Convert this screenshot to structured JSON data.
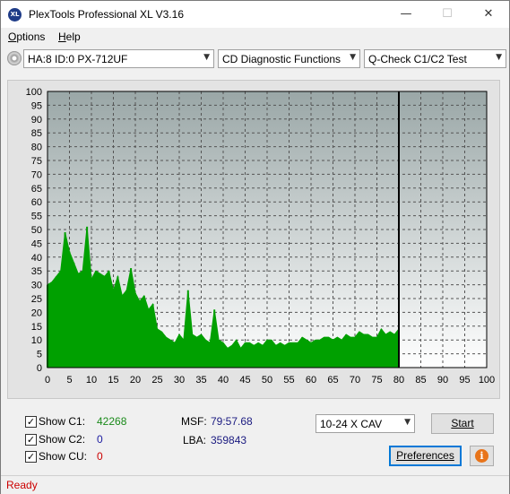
{
  "window": {
    "title": "PlexTools Professional XL V3.16",
    "app_icon_text": "XL",
    "minimize_glyph": "—",
    "maximize_glyph": "☐",
    "close_glyph": "✕"
  },
  "menu": {
    "options": {
      "underline": "O",
      "rest": "ptions"
    },
    "help": {
      "underline": "H",
      "rest": "elp"
    }
  },
  "toolbar": {
    "drive_select": "HA:8 ID:0  PX-712UF",
    "function_select": "CD Diagnostic Functions",
    "test_select": "Q-Check C1/C2 Test",
    "arrow_glyph": "▼"
  },
  "chart_data": {
    "type": "area",
    "title": "",
    "xlabel": "",
    "ylabel": "",
    "xlim": [
      0,
      100
    ],
    "ylim": [
      0,
      100
    ],
    "x_ticks": [
      0,
      5,
      10,
      15,
      20,
      25,
      30,
      35,
      40,
      45,
      50,
      55,
      60,
      65,
      70,
      75,
      80,
      85,
      90,
      95,
      100
    ],
    "y_ticks": [
      0,
      5,
      10,
      15,
      20,
      25,
      30,
      35,
      40,
      45,
      50,
      55,
      60,
      65,
      70,
      75,
      80,
      85,
      90,
      95,
      100
    ],
    "grid": true,
    "end_marker_x": 80,
    "series": [
      {
        "color": "#00a000",
        "x": [
          0,
          1,
          2,
          3,
          4,
          5,
          6,
          7,
          8,
          9,
          10,
          11,
          12,
          13,
          14,
          15,
          16,
          17,
          18,
          19,
          20,
          21,
          22,
          23,
          24,
          25,
          26,
          27,
          28,
          29,
          30,
          31,
          32,
          33,
          34,
          35,
          36,
          37,
          38,
          39,
          40,
          41,
          42,
          43,
          44,
          45,
          46,
          47,
          48,
          49,
          50,
          51,
          52,
          53,
          54,
          55,
          56,
          57,
          58,
          59,
          60,
          61,
          62,
          63,
          64,
          65,
          66,
          67,
          68,
          69,
          70,
          71,
          72,
          73,
          74,
          75,
          76,
          77,
          78,
          79,
          80
        ],
        "y": [
          30,
          31,
          33,
          35,
          49,
          42,
          38,
          34,
          35,
          51,
          32,
          35,
          34,
          33,
          35,
          28,
          33,
          26,
          28,
          36,
          27,
          24,
          26,
          21,
          23,
          14,
          13,
          11,
          10,
          9,
          12,
          10,
          28,
          12,
          11,
          12,
          10,
          9,
          21,
          10,
          9,
          7,
          8,
          10,
          7,
          9,
          9,
          8,
          9,
          8,
          10,
          10,
          8,
          9,
          8,
          9,
          9,
          9,
          11,
          10,
          9,
          10,
          10,
          11,
          11,
          10,
          11,
          10,
          12,
          11,
          11,
          13,
          12,
          12,
          11,
          11,
          14,
          12,
          13,
          12,
          14
        ]
      }
    ]
  },
  "options": {
    "show_c1_label": "Show C1:",
    "show_c1_value": "42268",
    "show_c2_label": "Show C2:",
    "show_c2_value": "0",
    "show_cu_label": "Show CU:",
    "show_cu_value": "0",
    "check_glyph": "✓",
    "c1_color": "#1a8a1a",
    "c2_color": "#1a1aa0",
    "cu_color": "#cc0000"
  },
  "info": {
    "msf_label": "MSF:",
    "msf_value": "79:57.68",
    "lba_label": "LBA:",
    "lba_value": "359843"
  },
  "controls": {
    "speed_select": "10-24 X CAV",
    "start_button": "Start",
    "preferences_button": "Preferences",
    "info_glyph": "i"
  },
  "status": {
    "text": "Ready",
    "color": "#cc0000"
  }
}
